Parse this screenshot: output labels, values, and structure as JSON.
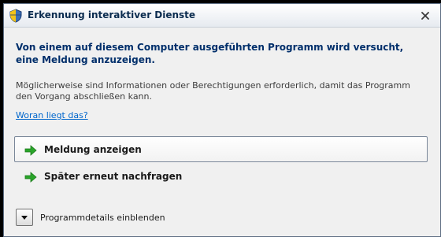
{
  "window": {
    "title": "Erkennung interaktiver Dienste",
    "title_icon": "shield-icon",
    "close_icon": "close-icon"
  },
  "message": {
    "headline": "Von einem auf diesem Computer ausgeführten Programm wird versucht, eine Meldung anzuzeigen.",
    "body": "Möglicherweise sind Informationen oder Berechtigungen erforderlich, damit das Programm den Vorgang abschließen kann.",
    "help_link": "Woran liegt das?"
  },
  "commands": [
    {
      "label": "Meldung anzeigen",
      "icon": "green-arrow-icon"
    },
    {
      "label": "Später erneut nachfragen",
      "icon": "green-arrow-icon"
    }
  ],
  "details": {
    "label": "Programmdetails einblenden",
    "icon": "chevron-down-icon"
  },
  "colors": {
    "headline": "#002f6b",
    "link": "#0066cc",
    "arrow": "#2aa52a",
    "background": "#f0f0f0"
  }
}
